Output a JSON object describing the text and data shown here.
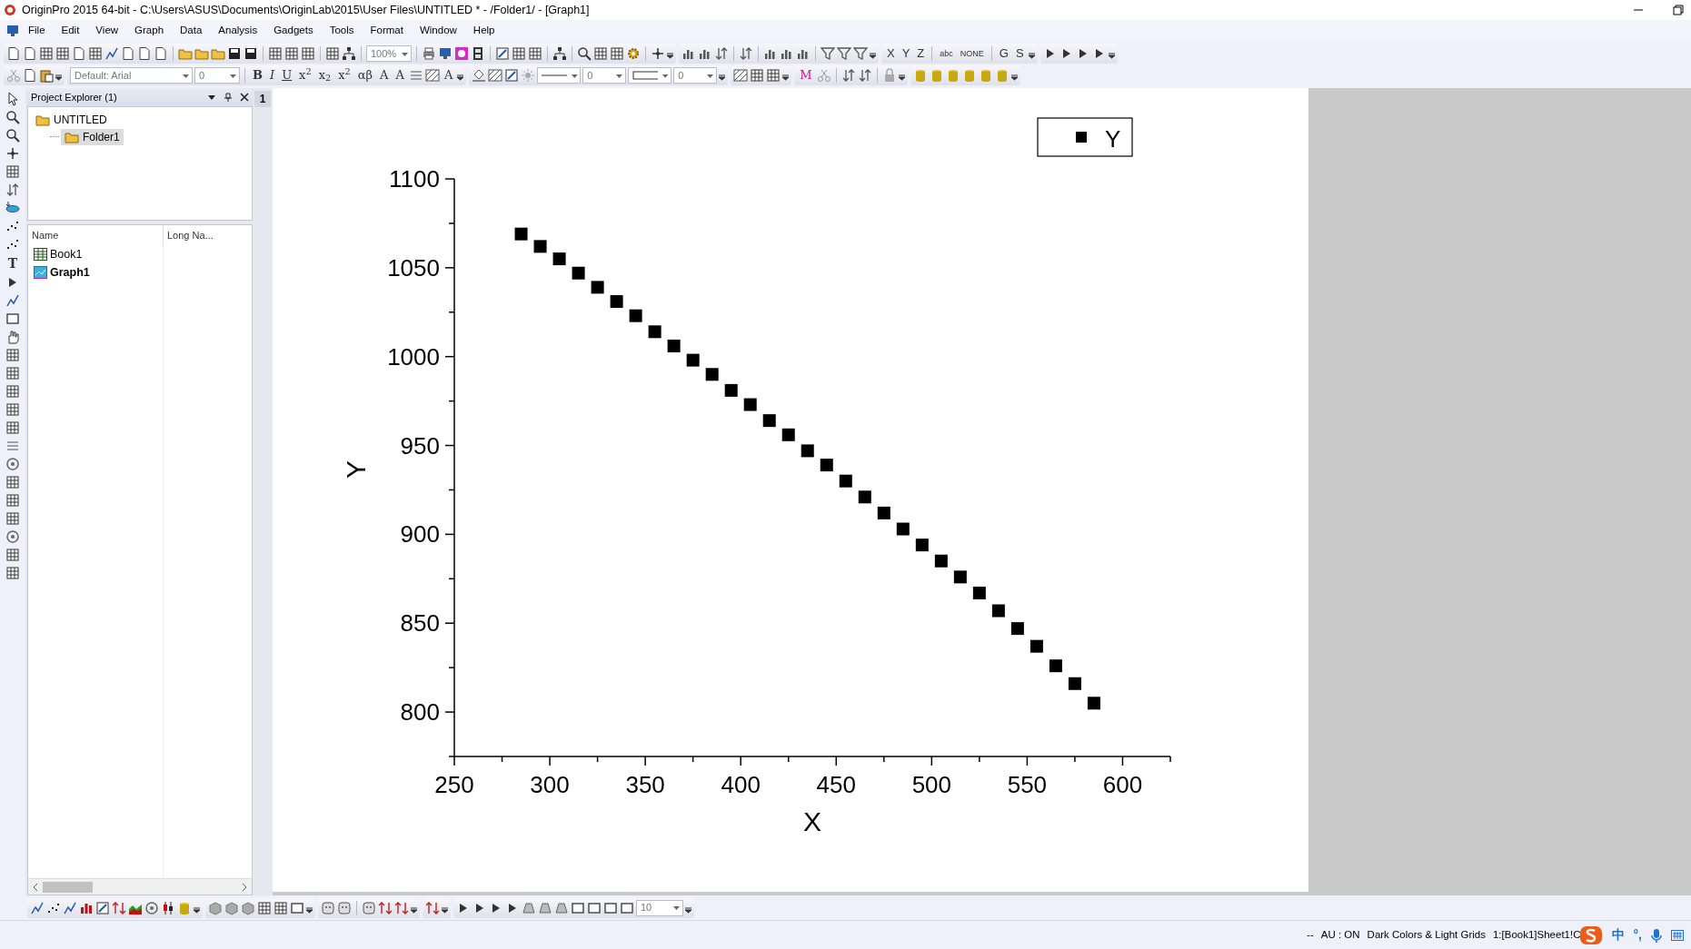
{
  "window": {
    "title": "OriginPro 2015 64-bit - C:\\Users\\ASUS\\Documents\\OriginLab\\2015\\User Files\\UNTITLED * - /Folder1/ - [Graph1]"
  },
  "menu": [
    "File",
    "Edit",
    "View",
    "Graph",
    "Data",
    "Analysis",
    "Gadgets",
    "Tools",
    "Format",
    "Window",
    "Help"
  ],
  "toolbar_row_1": {
    "zoom_combo": {
      "value": "100%"
    },
    "text_buttons": [
      "X",
      "Y",
      "Z",
      "abc",
      "NONE",
      "G",
      "S"
    ]
  },
  "toolbar_row_2": {
    "font_combo": {
      "value": "Default: Arial"
    },
    "size_combo": {
      "value": "0"
    },
    "text_buttons": [
      "B",
      "I",
      "U",
      "x$^{2}$",
      "x$_{2}$",
      "x$^{2}$",
      "αβ",
      "A",
      "A",
      "A",
      "M"
    ],
    "width_combo": {
      "value": "0"
    },
    "value_combo": {
      "value": "0"
    }
  },
  "left_toolbar": {
    "text_tool": "T"
  },
  "project_explorer": {
    "title": "Project Explorer (1)",
    "tree": [
      {
        "label": "UNTITLED",
        "selected": false,
        "children": [
          {
            "label": "Folder1",
            "selected": true
          }
        ]
      }
    ],
    "columns": [
      "Name",
      "Long Na..."
    ],
    "items": [
      {
        "name": "Book1",
        "kind": "workbook",
        "active": false
      },
      {
        "name": "Graph1",
        "kind": "graph",
        "active": true
      }
    ]
  },
  "graph": {
    "layer_tab": "1",
    "chart_data": {
      "type": "scatter",
      "xlabel": "X",
      "ylabel": "Y",
      "x": [
        285,
        295,
        305,
        315,
        325,
        335,
        345,
        355,
        365,
        375,
        385,
        395,
        405,
        415,
        425,
        435,
        445,
        455,
        465,
        475,
        485,
        495,
        505,
        515,
        525,
        535,
        545,
        555,
        565,
        575,
        585
      ],
      "series": [
        {
          "name": "Y",
          "color": "#000000",
          "values": [
            1069,
            1062,
            1055,
            1047,
            1039,
            1031,
            1023,
            1014,
            1006,
            998,
            990,
            981,
            973,
            964,
            956,
            947,
            939,
            930,
            921,
            912,
            903,
            894,
            885,
            876,
            867,
            857,
            847,
            837,
            826,
            816,
            805
          ]
        }
      ],
      "xlim": [
        250,
        625
      ],
      "ylim": [
        775,
        1100
      ],
      "xticks": [
        250,
        300,
        350,
        400,
        450,
        500,
        550,
        600
      ],
      "yticks": [
        800,
        850,
        900,
        950,
        1000,
        1050,
        1100
      ]
    }
  },
  "bottom_toolbar": {
    "combo": {
      "value": "10"
    }
  },
  "status_bar": [
    "--",
    "AU : ON",
    "Dark Colors & Light Grids",
    "1:[Book1]Sheet1!C"
  ],
  "ime_bar": {
    "labels": [
      "中",
      "°,"
    ]
  }
}
